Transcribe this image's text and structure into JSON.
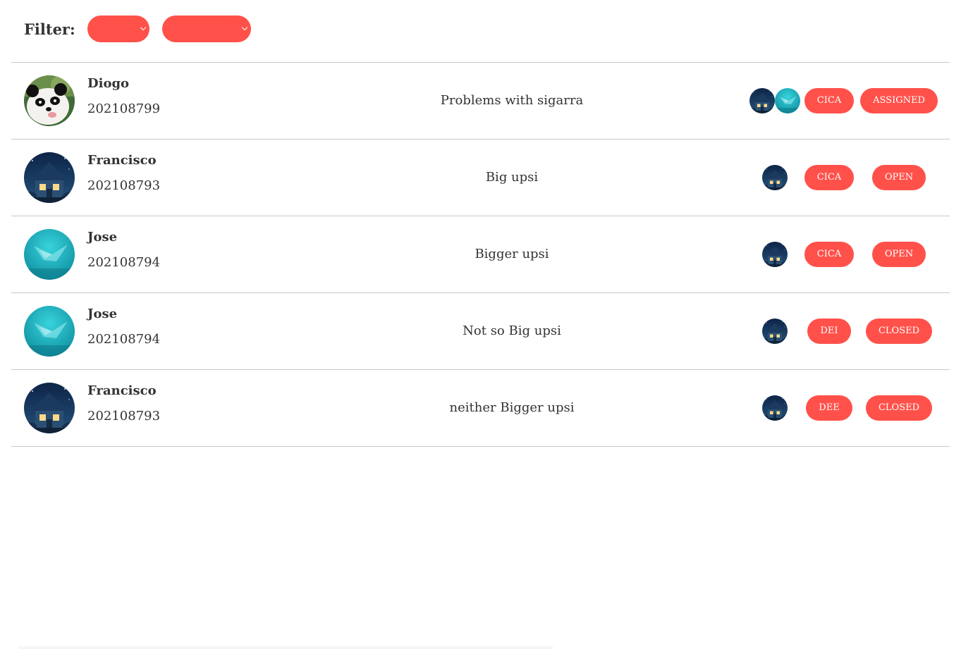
{
  "filter": {
    "label": "Filter:",
    "tag_select_value": "",
    "status_select_value": ""
  },
  "colors": {
    "accent": "#ff514a",
    "text": "#333333",
    "divider": "#c8c8c8"
  },
  "tickets": [
    {
      "author": {
        "name": "Diogo",
        "number": "202108799",
        "avatar": "panda-avatar"
      },
      "title": "Problems with sigarra",
      "assignees": [
        "night-house-avatar",
        "teal-avatar"
      ],
      "tag": "CICA",
      "status": "ASSIGNED"
    },
    {
      "author": {
        "name": "Francisco",
        "number": "202108793",
        "avatar": "night-house-avatar"
      },
      "title": "Big upsi",
      "assignees": [
        "night-house-avatar"
      ],
      "tag": "CICA",
      "status": "OPEN"
    },
    {
      "author": {
        "name": "Jose",
        "number": "202108794",
        "avatar": "teal-avatar"
      },
      "title": "Bigger upsi",
      "assignees": [
        "night-house-avatar"
      ],
      "tag": "CICA",
      "status": "OPEN"
    },
    {
      "author": {
        "name": "Jose",
        "number": "202108794",
        "avatar": "teal-avatar"
      },
      "title": "Not so Big upsi",
      "assignees": [
        "night-house-avatar"
      ],
      "tag": "DEI",
      "status": "CLOSED"
    },
    {
      "author": {
        "name": "Francisco",
        "number": "202108793",
        "avatar": "night-house-avatar"
      },
      "title": "neither Bigger upsi",
      "assignees": [
        "night-house-avatar"
      ],
      "tag": "DEE",
      "status": "CLOSED"
    }
  ]
}
